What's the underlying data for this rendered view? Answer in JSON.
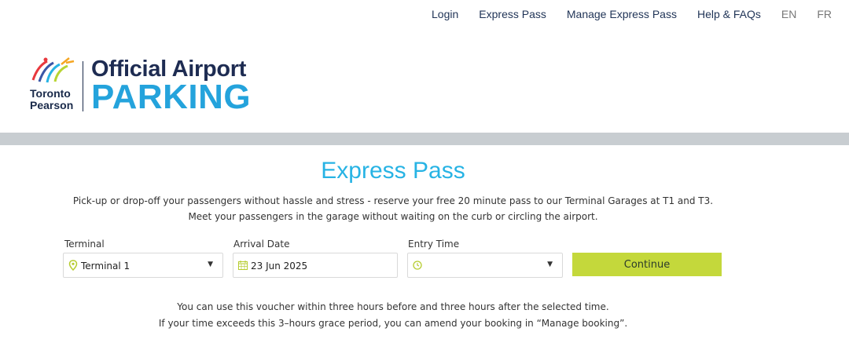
{
  "nav": {
    "links": [
      "Login",
      "Express Pass",
      "Manage Express Pass",
      "Help & FAQs"
    ],
    "languages": [
      "EN",
      "FR"
    ]
  },
  "logo": {
    "airport_line1": "Toronto",
    "airport_line2": "Pearson",
    "title_line1": "Official Airport",
    "title_line2": "PARKING"
  },
  "page": {
    "heading": "Express Pass",
    "intro_line1": "Pick-up or drop-off your passengers without hassle and stress - reserve your free 20 minute pass to our Terminal Garages at T1 and T3.",
    "intro_line2": "Meet your passengers in the garage without waiting on the curb or circling the airport."
  },
  "form": {
    "terminal_label": "Terminal",
    "terminal_value": "Terminal 1",
    "arrival_label": "Arrival Date",
    "arrival_value": "23 Jun 2025",
    "entry_label": "Entry Time",
    "entry_value": "",
    "continue_label": "Continue"
  },
  "note": {
    "line1": "You can use this voucher within three hours before and three hours after the selected time.",
    "line2": "If your time exceeds this 3–hours grace period, you can amend your booking in “Manage booking”."
  },
  "colors": {
    "accent_blue": "#27b3e4",
    "button_green": "#c4d83b",
    "navy": "#1f3356"
  }
}
